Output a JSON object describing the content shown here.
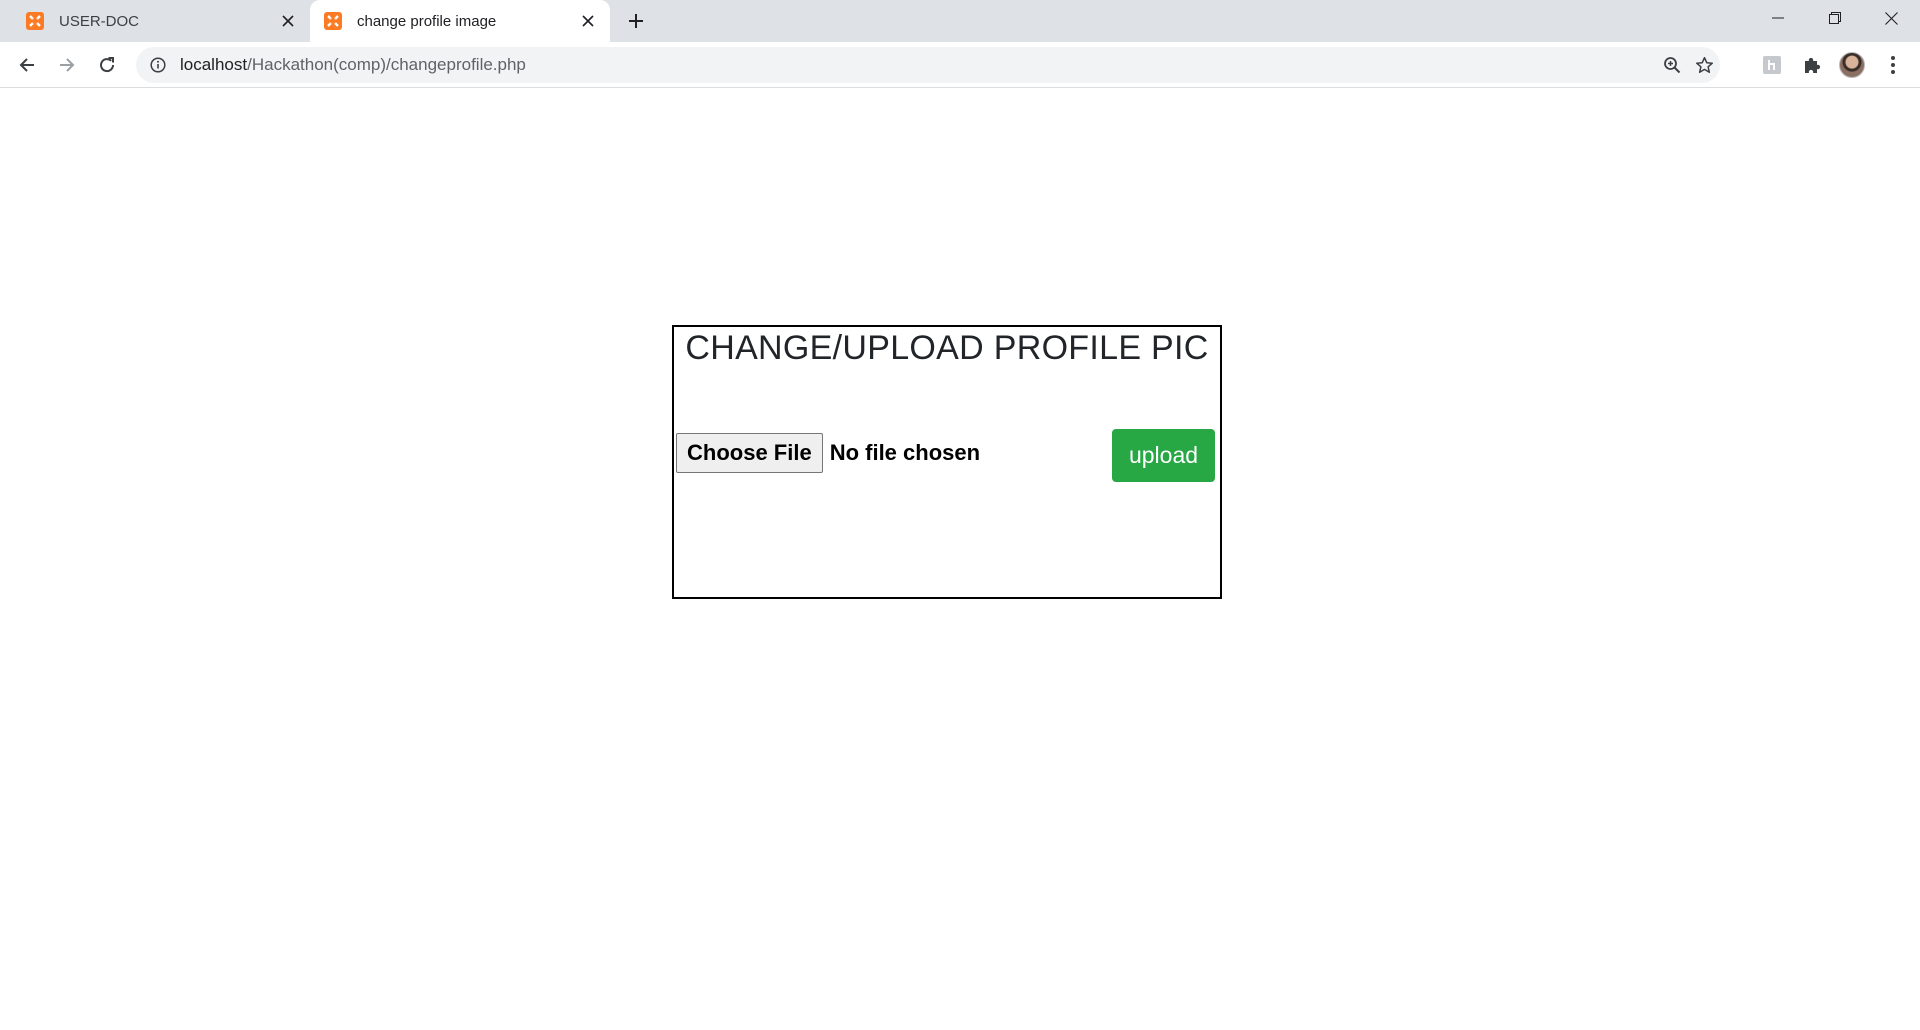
{
  "browser": {
    "tabs": [
      {
        "title": "USER-DOC",
        "active": false
      },
      {
        "title": "change profile image",
        "active": true
      }
    ],
    "url": {
      "host": "localhost",
      "path": "/Hackathon(comp)/changeprofile.php"
    },
    "icons": {
      "favicon": "xampp-icon",
      "close": "close-icon",
      "new_tab": "plus-icon",
      "back": "back-arrow-icon",
      "forward": "forward-arrow-icon",
      "reload": "reload-icon",
      "site_info": "info-icon",
      "zoom": "zoom-icon",
      "bookmark": "star-icon",
      "extension": "extension-icon",
      "extensions_menu": "puzzle-icon",
      "profile": "avatar",
      "menu": "kebab-menu-icon"
    },
    "colors": {
      "tabstrip": "#dee1e6",
      "favicon": "#fb7a24"
    }
  },
  "page": {
    "title": "CHANGE/UPLOAD PROFILE PIC",
    "file_input": {
      "button_label": "Choose File",
      "status": "No file chosen"
    },
    "upload_button": "upload",
    "colors": {
      "upload_button": "#28a745",
      "box_border": "#000000"
    }
  }
}
